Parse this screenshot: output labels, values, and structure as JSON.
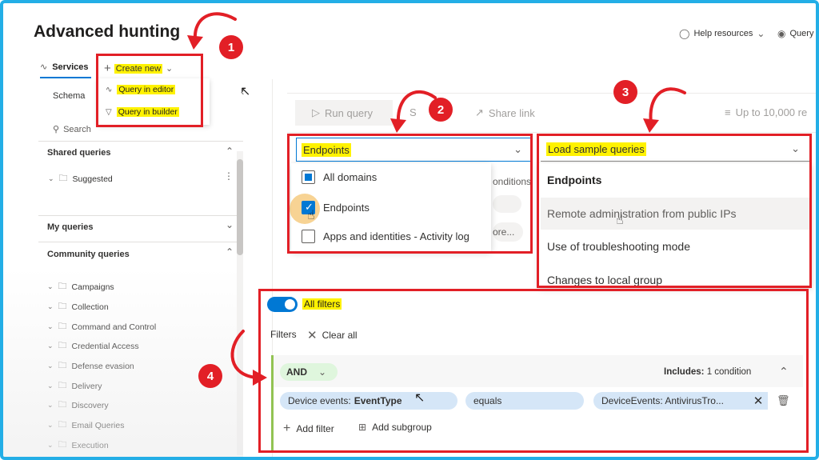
{
  "header": {
    "title": "Advanced hunting",
    "help_label": "Help resources",
    "query_label": "Query"
  },
  "left_panel": {
    "services_tab": "Services",
    "create_new": "Create new",
    "create_menu": [
      "Query in editor",
      "Query in builder"
    ],
    "schema_tab": "Schema",
    "search_label": "Search",
    "sections": {
      "shared": "Shared queries",
      "shared_items": [
        "Suggested"
      ],
      "my": "My queries",
      "community": "Community queries"
    },
    "community_folders": [
      "Campaigns",
      "Collection",
      "Command and Control",
      "Credential Access",
      "Defense evasion",
      "Delivery",
      "Discovery",
      "Email Queries",
      "Execution"
    ]
  },
  "toolbar": {
    "run_query": "Run query",
    "share_link": "Share link",
    "save_partial": "S",
    "limit": "Up to 10,000 re"
  },
  "domain_dropdown": {
    "selected": "Endpoints",
    "options": [
      "All domains",
      "Endpoints",
      "Apps and identities - Activity log"
    ],
    "behind_text_1": "onditions",
    "behind_text_2": "ore..."
  },
  "sample_queries": {
    "placeholder": "Load sample queries",
    "group": "Endpoints",
    "items": [
      "Remote administration from public IPs",
      "Use of troubleshooting mode",
      "Changes to local group"
    ]
  },
  "filters": {
    "toggle_label": "All filters",
    "filters_label": "Filters",
    "clear_all": "Clear all",
    "operator": "AND",
    "includes_prefix": "Includes:",
    "includes_value": "1 condition",
    "condition": {
      "field_prefix": "Device events:",
      "field_name": "EventType",
      "operator": "equals",
      "value": "DeviceEvents: AntivirusTro..."
    },
    "add_filter": "Add filter",
    "add_subgroup": "Add subgroup"
  },
  "annotations": {
    "badges": [
      "1",
      "2",
      "3",
      "4"
    ],
    "color": "#e21f26",
    "highlight": "#fff200"
  }
}
